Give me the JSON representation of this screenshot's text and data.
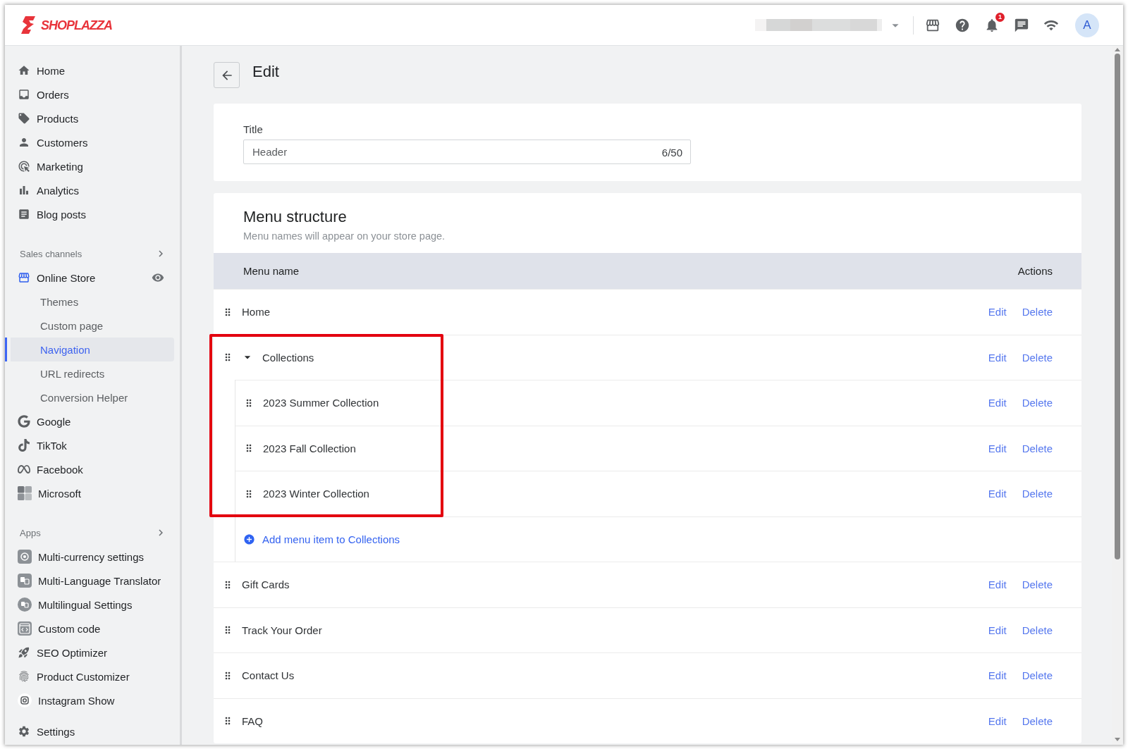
{
  "top_bar": {
    "logo": "SHOPLAZZA",
    "notification_count": "1",
    "avatar": "A"
  },
  "sidebar": {
    "sections": [
      {
        "items": [
          {
            "label": "Home",
            "selected": false
          },
          {
            "label": "Orders",
            "selected": false
          },
          {
            "label": "Products",
            "selected": false
          },
          {
            "label": "Customers",
            "selected": false
          },
          {
            "label": "Marketing",
            "selected": false
          },
          {
            "label": "Analytics",
            "selected": false
          },
          {
            "label": "Blog posts",
            "selected": false
          }
        ]
      },
      {
        "heading": "Sales channels",
        "items": [
          {
            "label": "Online Store",
            "selected": false,
            "children": [
              {
                "label": "Themes",
                "selected": false
              },
              {
                "label": "Custom page",
                "selected": false
              },
              {
                "label": "Navigation",
                "selected": true
              },
              {
                "label": "URL redirects",
                "selected": false
              },
              {
                "label": "Conversion Helper",
                "selected": false
              }
            ]
          },
          {
            "label": "Google",
            "selected": false
          },
          {
            "label": "TikTok",
            "selected": false
          },
          {
            "label": "Facebook",
            "selected": false
          },
          {
            "label": "Microsoft",
            "selected": false
          }
        ]
      },
      {
        "heading": "Apps",
        "items": [
          {
            "label": "Multi-currency settings",
            "selected": false
          },
          {
            "label": "Multi-Language Translator",
            "selected": false
          },
          {
            "label": "Multilingual Settings",
            "selected": false
          },
          {
            "label": "Custom code",
            "selected": false
          },
          {
            "label": "SEO Optimizer",
            "selected": false
          },
          {
            "label": "Product Customizer",
            "selected": false
          },
          {
            "label": "Instagram Show",
            "selected": false
          }
        ]
      },
      {
        "items": [
          {
            "label": "Settings",
            "selected": false
          }
        ]
      }
    ]
  },
  "page": {
    "title": "Edit"
  },
  "title_card": {
    "label": "Title",
    "value": "Header",
    "counter": "6/50"
  },
  "menu_card": {
    "heading": "Menu structure",
    "subtitle": "Menu names will appear on your store page.",
    "columns": [
      "Menu name",
      "Actions"
    ],
    "items": [
      {
        "name": "Home",
        "highlighted": false,
        "actions": [
          "Edit",
          "Delete"
        ]
      },
      {
        "name": "Collections",
        "highlighted": true,
        "expanded": true,
        "actions": [
          "Edit",
          "Delete"
        ],
        "children": [
          {
            "name": "2023 Summer Collection",
            "actions": [
              "Edit",
              "Delete"
            ]
          },
          {
            "name": "2023 Fall Collection",
            "actions": [
              "Edit",
              "Delete"
            ]
          },
          {
            "name": "2023 Winter Collection",
            "actions": [
              "Edit",
              "Delete"
            ]
          }
        ],
        "add_label": "Add menu item to Collections"
      },
      {
        "name": "Gift Cards",
        "highlighted": false,
        "actions": [
          "Edit",
          "Delete"
        ]
      },
      {
        "name": "Track Your Order",
        "highlighted": false,
        "actions": [
          "Edit",
          "Delete"
        ]
      },
      {
        "name": "Contact Us",
        "highlighted": false,
        "actions": [
          "Edit",
          "Delete"
        ]
      },
      {
        "name": "FAQ",
        "highlighted": false,
        "actions": [
          "Edit",
          "Delete"
        ]
      }
    ]
  }
}
